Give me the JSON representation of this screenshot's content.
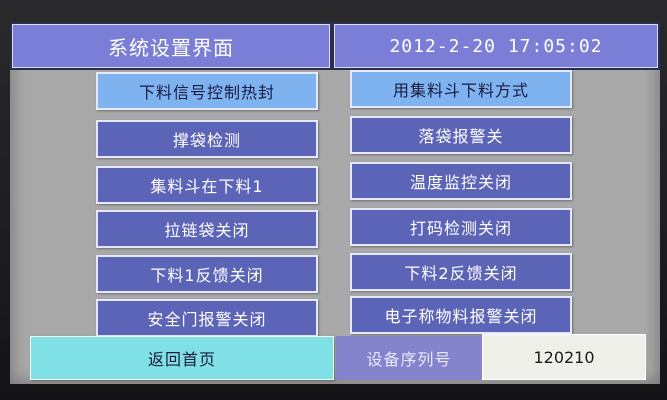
{
  "header": {
    "title": "系统设置界面",
    "datetime": "2012-2-20 17:05:02"
  },
  "left_buttons": [
    {
      "label": "下料信号控制热封"
    },
    {
      "label": "撑袋检测"
    },
    {
      "label": "集料斗在下料1"
    },
    {
      "label": "拉链袋关闭"
    },
    {
      "label": "下料1反馈关闭"
    },
    {
      "label": "安全门报警关闭"
    }
  ],
  "right_buttons": [
    {
      "label": "用集料斗下料方式"
    },
    {
      "label": "落袋报警关"
    },
    {
      "label": "温度监控关闭"
    },
    {
      "label": "打码检测关闭"
    },
    {
      "label": "下料2反馈关闭"
    },
    {
      "label": "电子称物料报警关闭"
    }
  ],
  "footer": {
    "home_label": "返回首页",
    "serial_label": "设备序列号",
    "serial_value": "120210"
  },
  "colors": {
    "panel": "#7a7ed6",
    "button_dark": "#5c64b8",
    "button_light": "#7fb3f0",
    "home_button": "#7fe0e6",
    "screen_bg": "#a9a9a9"
  }
}
